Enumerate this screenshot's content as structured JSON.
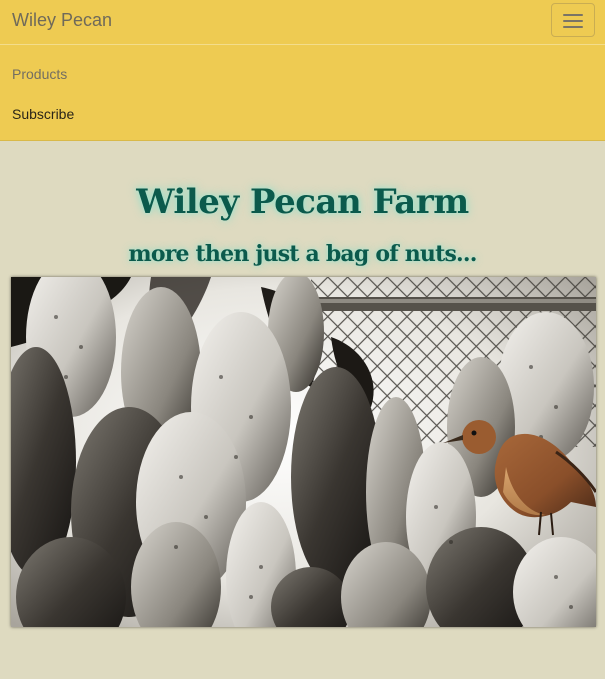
{
  "navbar": {
    "brand": "Wiley Pecan",
    "toggle_icon": "hamburger-menu-icon",
    "items": [
      {
        "label": "Products"
      },
      {
        "label": "Subscribe"
      }
    ],
    "background_color": "#eecb52"
  },
  "hero": {
    "title": "Wiley Pecan Farm",
    "subtitle": "more then just a bag of nuts...",
    "title_color": "#0b5a4c"
  },
  "page": {
    "background_color": "#dedac0"
  }
}
